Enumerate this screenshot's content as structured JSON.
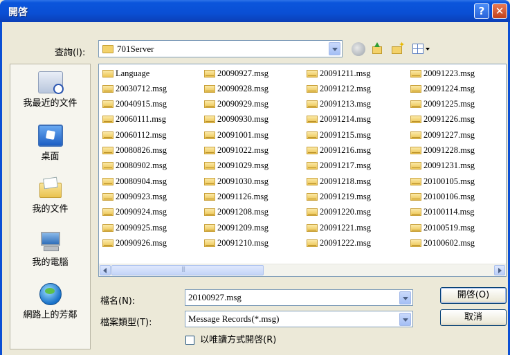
{
  "window": {
    "title": "開啓",
    "help_label": "?",
    "close_label": "✕"
  },
  "lookin": {
    "label": "查詢(I):",
    "value": "701Server"
  },
  "places": [
    "我最近的文件",
    "桌面",
    "我的文件",
    "我的電腦",
    "網路上的芳鄰"
  ],
  "files": {
    "col1": [
      "Language",
      "20030712.msg",
      "20040915.msg",
      "20060111.msg",
      "20060112.msg",
      "20080826.msg",
      "20080902.msg",
      "20080904.msg",
      "20090923.msg",
      "20090924.msg",
      "20090925.msg",
      "20090926.msg"
    ],
    "col2": [
      "20090927.msg",
      "20090928.msg",
      "20090929.msg",
      "20090930.msg",
      "20091001.msg",
      "20091022.msg",
      "20091029.msg",
      "20091030.msg",
      "20091126.msg",
      "20091208.msg",
      "20091209.msg",
      "20091210.msg"
    ],
    "col3": [
      "20091211.msg",
      "20091212.msg",
      "20091213.msg",
      "20091214.msg",
      "20091215.msg",
      "20091216.msg",
      "20091217.msg",
      "20091218.msg",
      "20091219.msg",
      "20091220.msg",
      "20091221.msg",
      "20091222.msg"
    ],
    "col4": [
      "20091223.msg",
      "20091224.msg",
      "20091225.msg",
      "20091226.msg",
      "20091227.msg",
      "20091228.msg",
      "20091231.msg",
      "20100105.msg",
      "20100106.msg",
      "20100114.msg",
      "20100519.msg",
      "20100602.msg"
    ]
  },
  "filename": {
    "label": "檔名(N):",
    "value": "20100927.msg"
  },
  "filetype": {
    "label": "檔案類型(T):",
    "value": "Message Records(*.msg)"
  },
  "readonly_label": "以唯讀方式開啓(R)",
  "buttons": {
    "open": "開啓(O)",
    "cancel": "取消"
  }
}
